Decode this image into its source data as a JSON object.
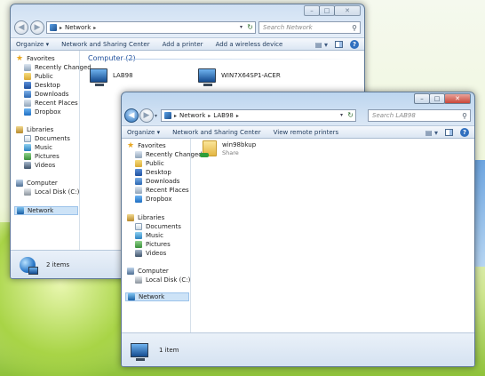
{
  "back_window": {
    "address": {
      "root_chevron": "▸",
      "crumbs": [
        {
          "label": "Network",
          "chevron": "▸"
        }
      ]
    },
    "search": {
      "placeholder": "Search Network"
    },
    "toolbar": {
      "items": [
        "Organize ▾",
        "Network and Sharing Center",
        "Add a printer",
        "Add a wireless device"
      ]
    },
    "nav": {
      "favorites": "Favorites",
      "favorite_items": [
        "Recently Changed",
        "Public",
        "Desktop",
        "Downloads",
        "Recent Places",
        "Dropbox"
      ],
      "libraries": "Libraries",
      "library_items": [
        "Documents",
        "Music",
        "Pictures",
        "Videos"
      ],
      "computer": "Computer",
      "computer_items": [
        "Local Disk (C:)"
      ],
      "network": "Network"
    },
    "group_header": "Computer (2)",
    "items": [
      "LAB98",
      "WIN7X64SP1-ACER"
    ],
    "status": "2 items"
  },
  "front_window": {
    "address": {
      "root_chevron": "▸",
      "crumbs": [
        {
          "label": "Network",
          "chevron": "▸"
        },
        {
          "label": "LAB98",
          "chevron": "▸"
        }
      ]
    },
    "search": {
      "placeholder": "Search LAB98"
    },
    "toolbar": {
      "items": [
        "Organize ▾",
        "Network and Sharing Center",
        "View remote printers"
      ]
    },
    "nav": {
      "favorites": "Favorites",
      "favorite_items": [
        "Recently Changed",
        "Public",
        "Desktop",
        "Downloads",
        "Recent Places",
        "Dropbox"
      ],
      "libraries": "Libraries",
      "library_items": [
        "Documents",
        "Music",
        "Pictures",
        "Videos"
      ],
      "computer": "Computer",
      "computer_items": [
        "Local Disk (C:)"
      ],
      "network": "Network"
    },
    "share": {
      "name": "win98bkup",
      "type": "Share"
    },
    "status": "1 item"
  },
  "caption_glyphs": {
    "minimize": "–",
    "maximize": "□",
    "close": "✕"
  },
  "glyphs": {
    "back": "◀",
    "forward": "▶",
    "dropdown": "▾",
    "refresh": "↻",
    "search": "⚲",
    "views": "▤ ▾",
    "help": "?",
    "star": "★"
  },
  "colors": {
    "accent": "#1e4f9c",
    "selection": "#cde3f7",
    "wallpaper_green": "#8fc23a"
  }
}
